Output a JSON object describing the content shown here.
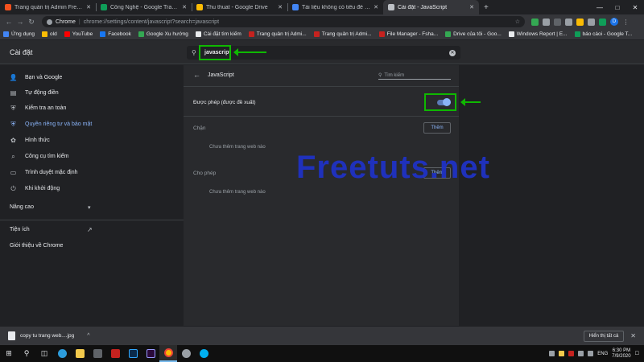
{
  "tabs": [
    {
      "title": "Trang quản trị Admin Freetuts!",
      "color": "#f4511e",
      "active": false
    },
    {
      "title": "Công Nghệ - Google Trang tính",
      "color": "#0f9d58",
      "active": false
    },
    {
      "title": "Thu thuat - Google Drive",
      "color": "#fbbc04",
      "active": false
    },
    {
      "title": "Tài liệu không có tiêu đề - Google",
      "color": "#4285f4",
      "active": false
    },
    {
      "title": "Cài đặt - JavaScript",
      "color": "#bdc1c6",
      "active": true
    }
  ],
  "toolbar": {
    "site_label": "Chrome",
    "url": "chrome://settings/content/javascript?search=javascript",
    "avatar_letter": "D"
  },
  "bookmarks": [
    {
      "label": "Ứng dụng",
      "color": "#4285f4"
    },
    {
      "label": "old",
      "color": "#fbbc04"
    },
    {
      "label": "YouTube",
      "color": "#ff0000"
    },
    {
      "label": "Facebook",
      "color": "#1877f2"
    },
    {
      "label": "Google Xu hướng",
      "color": "#34a853"
    },
    {
      "label": "Cài đặt tìm kiếm",
      "color": "#e8eaed"
    },
    {
      "label": "Trang quản trị Admi...",
      "color": "#c5221f"
    },
    {
      "label": "Trang quản trị Admi...",
      "color": "#c5221f"
    },
    {
      "label": "File Manager - Fsha...",
      "color": "#c5221f"
    },
    {
      "label": "Drive của tôi - Goo...",
      "color": "#34a853"
    },
    {
      "label": "Windows Report | E...",
      "color": "#e8eaed"
    },
    {
      "label": "báo cáoi - Google T...",
      "color": "#0f9d58"
    }
  ],
  "settings": {
    "title": "Cài đặt",
    "search_value": "javascript"
  },
  "sidebar": {
    "items": [
      {
        "label": "Bạn và Google",
        "icon": "person-icon",
        "glyph": "👤"
      },
      {
        "label": "Tự động điền",
        "icon": "autofill-icon",
        "glyph": "▤"
      },
      {
        "label": "Kiểm tra an toàn",
        "icon": "shield-icon",
        "glyph": "⛨"
      },
      {
        "label": "Quyền riêng tư và bảo mật",
        "icon": "privacy-shield-icon",
        "glyph": "⛨"
      },
      {
        "label": "Hình thức",
        "icon": "palette-icon",
        "glyph": "✿"
      },
      {
        "label": "Công cụ tìm kiếm",
        "icon": "search-icon",
        "glyph": "⌕"
      },
      {
        "label": "Trình duyệt mặc định",
        "icon": "browser-icon",
        "glyph": "▭"
      },
      {
        "label": "Khi khởi động",
        "icon": "power-icon",
        "glyph": "⏻"
      }
    ],
    "advanced": "Nâng cao",
    "extensions": "Tiện ích",
    "about": "Giới thiệu về Chrome"
  },
  "content": {
    "section_title": "JavaScript",
    "search_placeholder": "Tìm kiếm",
    "allowed_label": "Được phép (được đề xuất)",
    "allowed_toggle_on": true,
    "block_label": "Chặn",
    "block_add": "Thêm",
    "block_empty": "Chưa thêm trang web nào",
    "allow_label": "Cho phép",
    "allow_add": "Thêm",
    "allow_empty": "Chưa thêm trang web nào"
  },
  "watermark": "Freetuts.net",
  "download": {
    "file_name": "copy tu trang web....jpg",
    "show_all": "Hiển thị tất cả"
  },
  "taskbar": {
    "lang": "ENG",
    "time": "6:30 PM",
    "date": "7/9/2020"
  },
  "colors": {
    "accent": "#8ab4f8",
    "annotation": "#0fb800",
    "watermark": "#1f32c4"
  }
}
